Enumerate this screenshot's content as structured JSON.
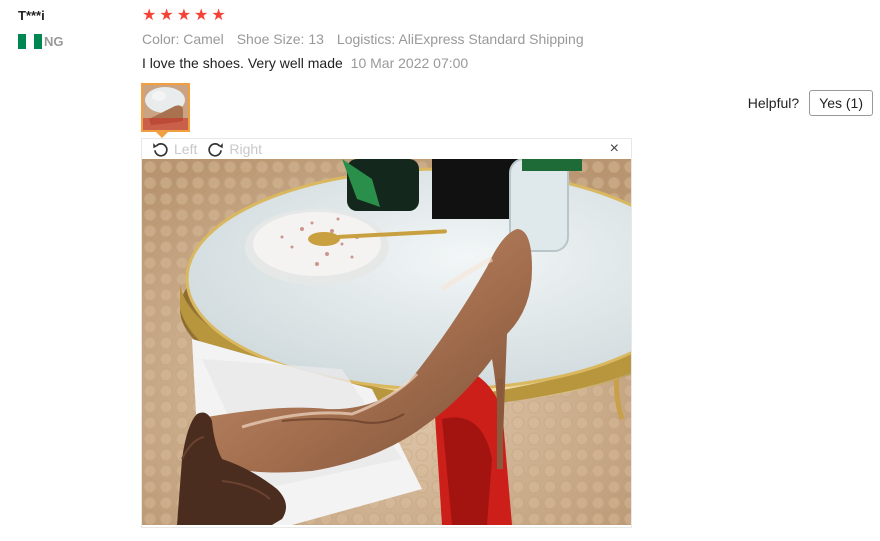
{
  "reviewer": {
    "name": "T***i",
    "country_code": "NG",
    "flag_colors": [
      "#008751",
      "#ffffff",
      "#008751"
    ]
  },
  "rating": {
    "stars": 5,
    "max": 5,
    "star_color": "#f44336"
  },
  "attributes": {
    "color_label": "Color:",
    "color_value": "Camel",
    "size_label": "Shoe Size:",
    "size_value": "13",
    "logistics_label": "Logistics:",
    "logistics_value": "AliExpress Standard Shipping"
  },
  "review": {
    "text": "I love the shoes. Very well made",
    "date": "10 Mar 2022 07:00"
  },
  "helpful": {
    "label": "Helpful?",
    "button": "Yes (1)"
  },
  "viewer": {
    "rotate_left_label": "Left",
    "rotate_right_label": "Right",
    "close_symbol": "×"
  },
  "icons": {
    "star": "star-icon",
    "rotate_left": "rotate-left-icon",
    "rotate_right": "rotate-right-icon",
    "close": "close-icon"
  }
}
